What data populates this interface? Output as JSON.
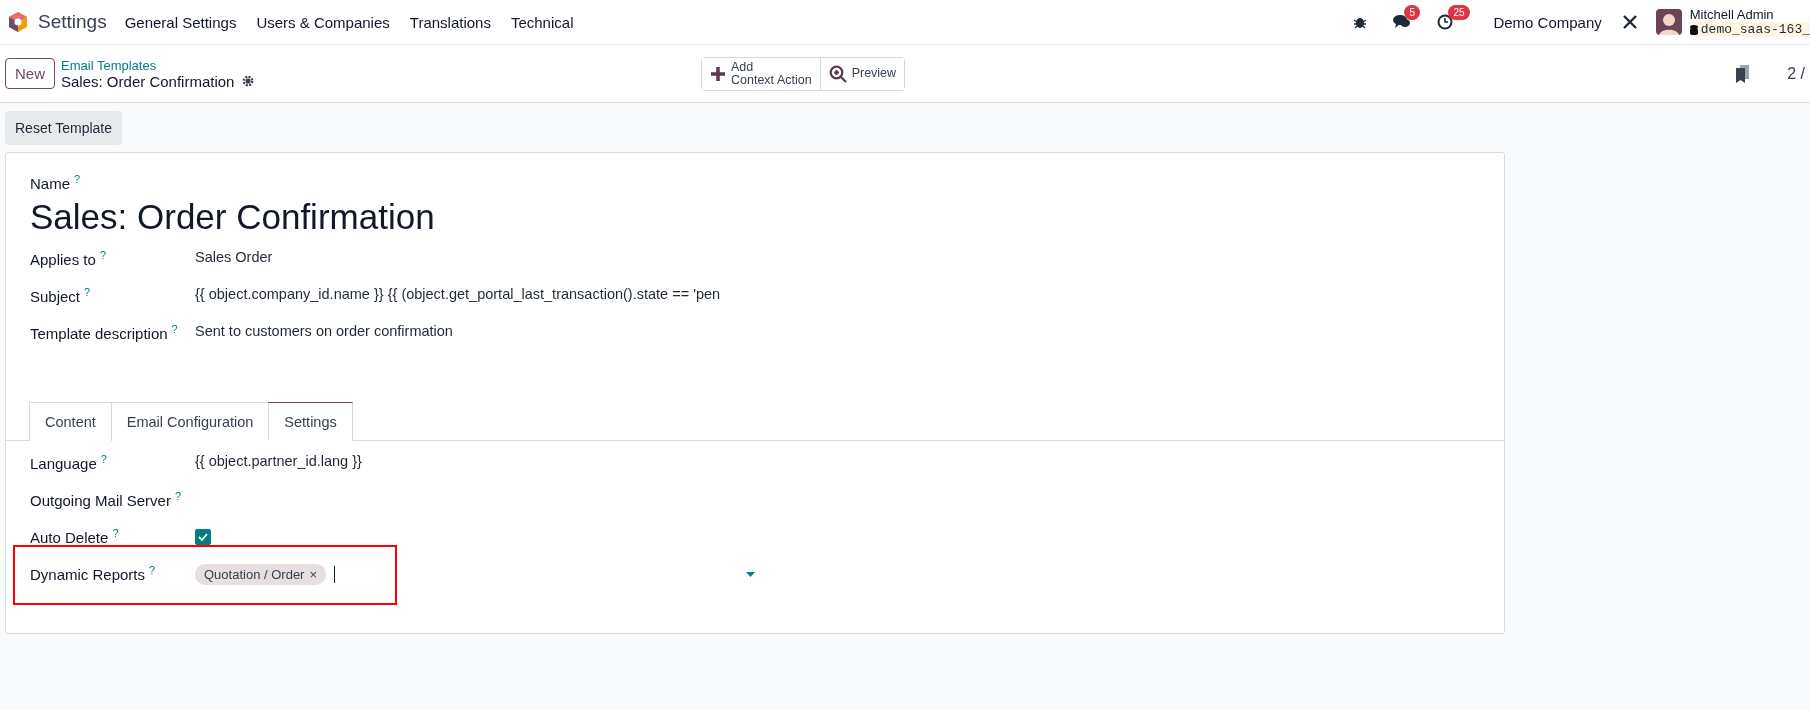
{
  "navbar": {
    "app_name": "Settings",
    "menus": [
      "General Settings",
      "Users & Companies",
      "Translations",
      "Technical"
    ],
    "systray": {
      "chat_count": "5",
      "activity_count": "25",
      "company": "Demo Company",
      "user_name": "Mitchell Admin",
      "database": "demo_saas-163_"
    }
  },
  "control_panel": {
    "new_button": "New",
    "breadcrumb": "Email Templates",
    "record_title": "Sales: Order Confirmation",
    "actions": [
      {
        "kind": "add",
        "lines": [
          "Add",
          "Context Action"
        ]
      },
      {
        "kind": "preview",
        "lines": [
          "Preview"
        ]
      }
    ],
    "pager": "2 /"
  },
  "reset_button": "Reset Template",
  "form": {
    "name_label": "Name",
    "name_help": "?",
    "name": "Sales: Order Confirmation",
    "fields": [
      {
        "label": "Applies to",
        "help": "?",
        "value": "Sales Order"
      },
      {
        "label": "Subject",
        "help": "?",
        "value": "{{ object.company_id.name }} {{ (object.get_portal_last_transaction().state == 'pen"
      },
      {
        "label": "Template description",
        "help": "?",
        "value": "Sent to customers on order confirmation"
      }
    ],
    "tabs": [
      {
        "label": "Content",
        "selected": false
      },
      {
        "label": "Email Configuration",
        "selected": false
      },
      {
        "label": "Settings",
        "selected": true
      }
    ],
    "settings": [
      {
        "kind": "text",
        "label": "Language",
        "help": "?",
        "value": "{{ object.partner_id.lang }}",
        "highlighted": false
      },
      {
        "kind": "empty",
        "label": "Outgoing Mail Server",
        "help": "?",
        "highlighted": false
      },
      {
        "kind": "checkbox",
        "label": "Auto Delete",
        "help": "?",
        "checked": true,
        "highlighted": false
      },
      {
        "kind": "tags",
        "label": "Dynamic Reports",
        "help": "?",
        "tags": [
          "Quotation / Order"
        ],
        "remove": "×",
        "highlighted": true
      }
    ]
  }
}
